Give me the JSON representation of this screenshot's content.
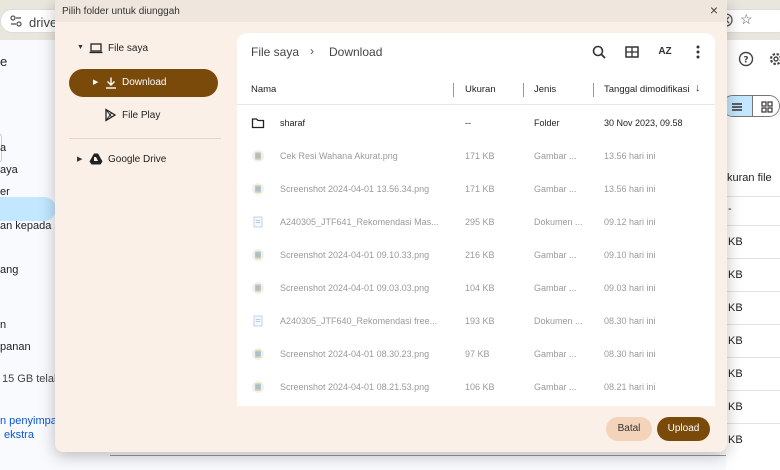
{
  "browser": {
    "url": "drive.g"
  },
  "background": {
    "sidebar": [
      {
        "label": "e"
      },
      {
        "label": "a"
      },
      {
        "label": "aya"
      },
      {
        "label": "er"
      },
      {
        "label": "an kepada sa"
      },
      {
        "label": "ang"
      },
      {
        "label": "n"
      },
      {
        "label": "panan"
      }
    ],
    "storage_text": "15 GB telah",
    "promo_line1": "n penyimpar",
    "promo_line2": "ekstra",
    "column_header": "kuran file",
    "sizes": [
      "KB",
      "KB",
      "KB",
      "KB",
      "KB",
      "KB",
      "KB"
    ],
    "help_icon": "help-icon",
    "settings_icon": "gear-icon"
  },
  "dialog": {
    "title": "Pilih folder untuk diunggah",
    "tree": {
      "my_files": "File saya",
      "download": "Download",
      "play_files": "File Play",
      "google_drive": "Google Drive"
    },
    "breadcrumb": {
      "root": "File saya",
      "current": "Download"
    },
    "columns": {
      "name": "Nama",
      "size": "Ukuran",
      "type": "Jenis",
      "modified": "Tanggal dimodifikasi"
    },
    "sort_label": "AZ",
    "files": [
      {
        "name": "sharaf",
        "size": "--",
        "type": "Folder",
        "date": "30 Nov 2023, 09.58",
        "icon": "folder-icon",
        "dim": false
      },
      {
        "name": "Cek Resi Wahana Akurat.png",
        "size": "171 KB",
        "type": "Gambar ...",
        "date": "13.56 hari ini",
        "icon": "image-icon",
        "dim": true
      },
      {
        "name": "Screenshot 2024-04-01 13.56.34.png",
        "size": "171 KB",
        "type": "Gambar ...",
        "date": "13.56 hari ini",
        "icon": "image-icon",
        "dim": true
      },
      {
        "name": "A240305_JTF641_Rekomendasi Mas...",
        "size": "295 KB",
        "type": "Dokumen ...",
        "date": "09.12 hari ini",
        "icon": "document-icon",
        "dim": true
      },
      {
        "name": "Screenshot 2024-04-01 09.10.33.png",
        "size": "216 KB",
        "type": "Gambar ...",
        "date": "09.10 hari ini",
        "icon": "image-icon",
        "dim": true
      },
      {
        "name": "Screenshot 2024-04-01 09.03.03.png",
        "size": "104 KB",
        "type": "Gambar ...",
        "date": "09.03 hari ini",
        "icon": "image-icon",
        "dim": true
      },
      {
        "name": "A240305_JTF640_Rekomendasi free...",
        "size": "193 KB",
        "type": "Dokumen ...",
        "date": "08.30 hari ini",
        "icon": "document-icon",
        "dim": true
      },
      {
        "name": "Screenshot 2024-04-01 08.30.23.png",
        "size": "97 KB",
        "type": "Gambar ...",
        "date": "08.30 hari ini",
        "icon": "image-icon",
        "dim": true
      },
      {
        "name": "Screenshot 2024-04-01 08.21.53.png",
        "size": "106 KB",
        "type": "Gambar ...",
        "date": "08.21 hari ini",
        "icon": "image-icon",
        "dim": true
      }
    ],
    "buttons": {
      "cancel": "Batal",
      "upload": "Upload"
    }
  },
  "colors": {
    "accent": "#7a4a0b",
    "dialog_bg": "#fbf0e8",
    "cancel_bg": "#f3d3b9",
    "drive_selection": "#c2e7ff"
  }
}
